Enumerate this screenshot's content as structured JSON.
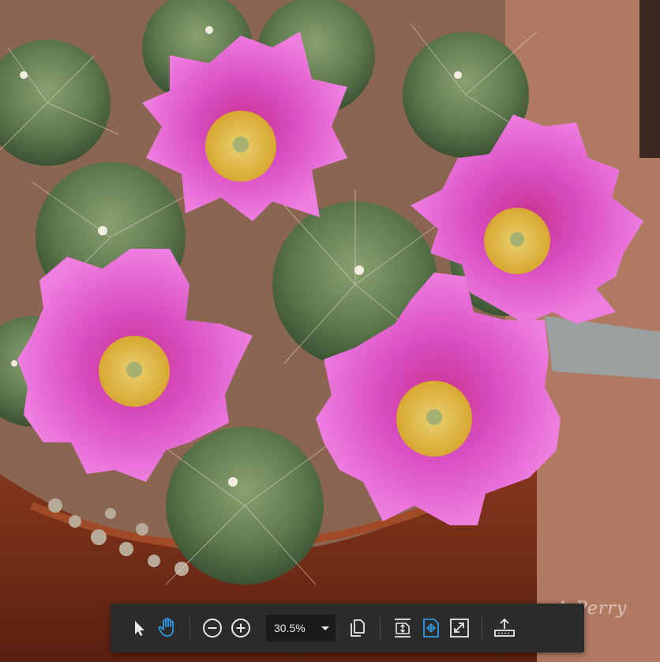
{
  "photo": {
    "watermark": "A Perry"
  },
  "toolbar": {
    "zoom_value": "30.5%"
  },
  "colors": {
    "toolbar_bg": "#2b2b2b",
    "accent_blue": "#2f9be8",
    "icon_white": "#e8e8e8",
    "petal_pink": "#e154c8",
    "pot_brown": "#7a2f18"
  },
  "icons": [
    "select-arrow-icon",
    "hand-pan-icon",
    "zoom-out-icon",
    "zoom-in-icon",
    "chevron-down-icon",
    "copy-icon",
    "fit-height-icon",
    "fit-page-icon",
    "fullscreen-icon",
    "upload-icon"
  ]
}
